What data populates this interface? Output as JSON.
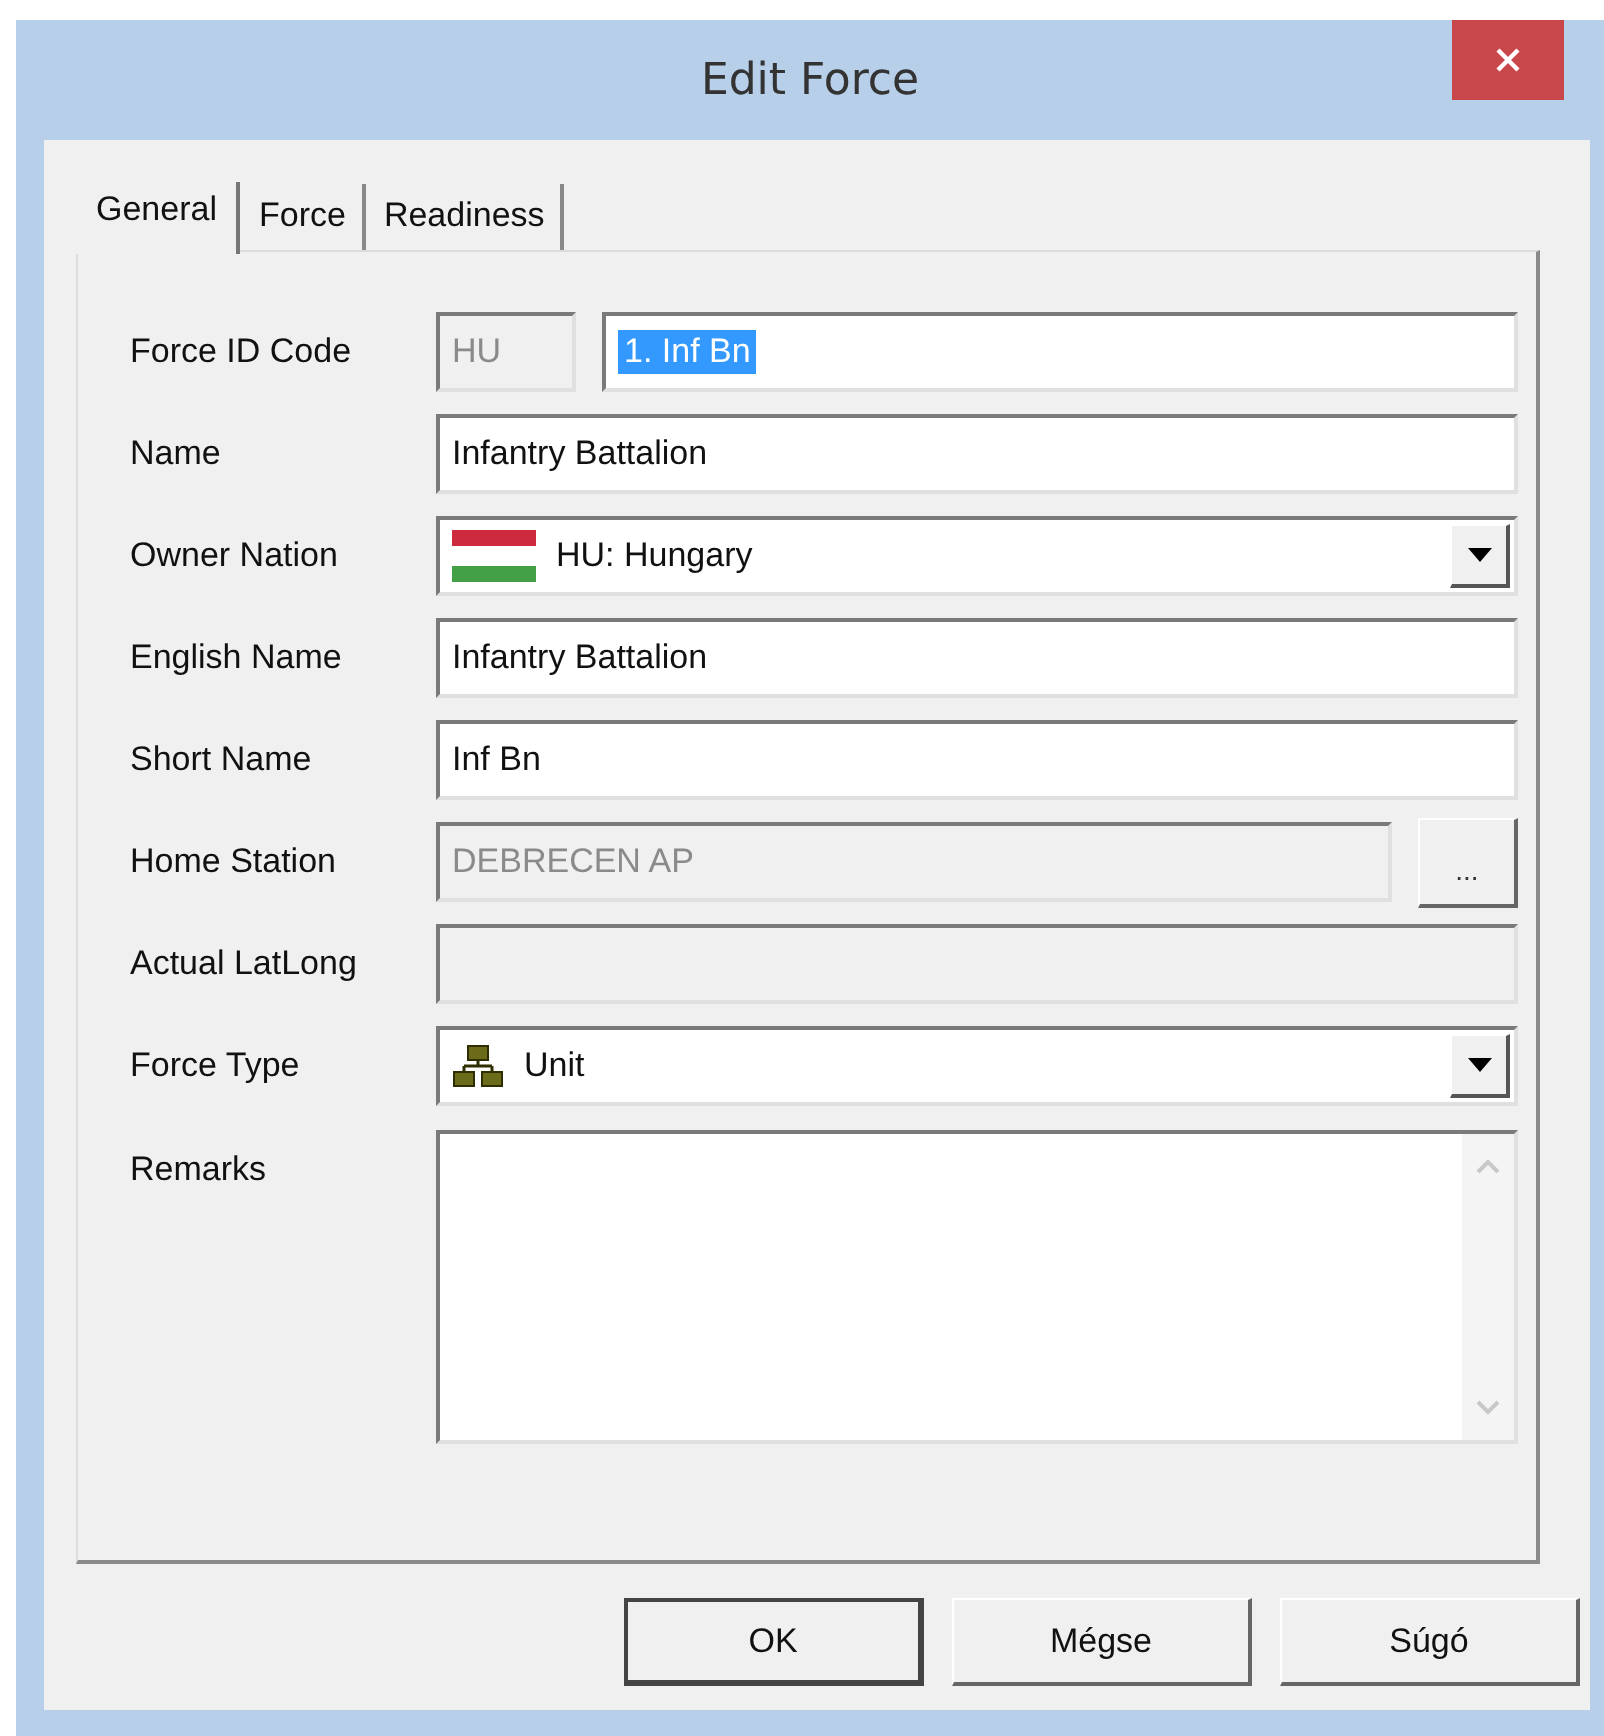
{
  "window": {
    "title": "Edit Force"
  },
  "tabs": [
    {
      "label": "General",
      "selected": true
    },
    {
      "label": "Force",
      "selected": false
    },
    {
      "label": "Readiness",
      "selected": false
    }
  ],
  "fields": [
    {
      "kind": "id_code",
      "label": "Force ID Code",
      "prefix": "HU",
      "prefix_disabled": true,
      "value": "1. Inf Bn",
      "value_selected": true
    },
    {
      "kind": "text",
      "label": "Name",
      "value": "Infantry Battalion",
      "disabled": false
    },
    {
      "kind": "flag_dropdown",
      "label": "Owner Nation",
      "value": "HU: Hungary"
    },
    {
      "kind": "text",
      "label": "English Name",
      "value": "Infantry Battalion",
      "disabled": false
    },
    {
      "kind": "text",
      "label": "Short Name",
      "value": "Inf Bn",
      "disabled": false
    },
    {
      "kind": "browse",
      "label": "Home Station",
      "value": "DEBRECEN AP",
      "disabled": true,
      "button": "..."
    },
    {
      "kind": "text",
      "label": "Actual LatLong",
      "disabled": true
    },
    {
      "kind": "unit_dropdown",
      "label": "Force Type",
      "value": "Unit"
    },
    {
      "kind": "memo",
      "label": "Remarks"
    }
  ],
  "buttons": [
    {
      "label": "OK",
      "default": true
    },
    {
      "label": "Mégse",
      "default": false
    },
    {
      "label": "Súgó",
      "default": false
    }
  ]
}
